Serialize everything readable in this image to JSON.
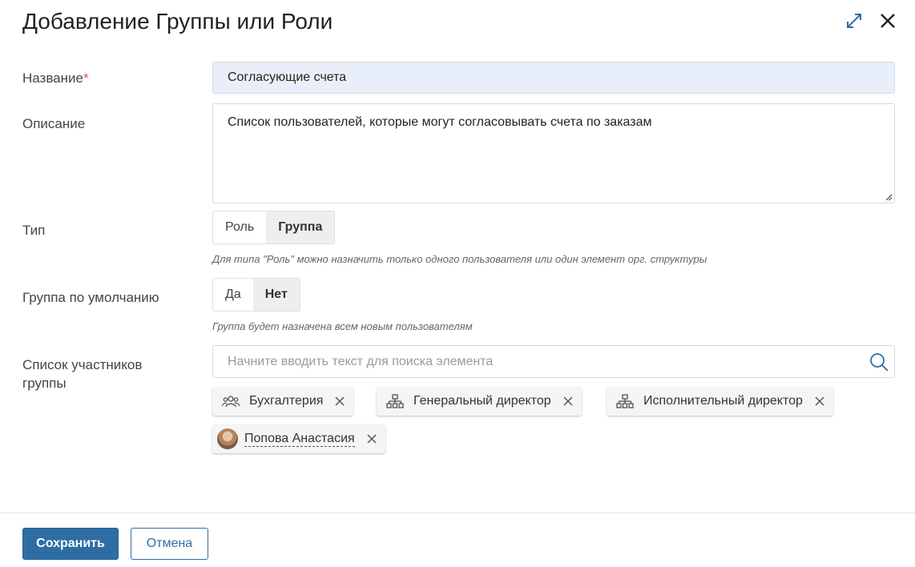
{
  "dialog": {
    "title": "Добавление Группы или Роли",
    "expand_icon": "expand-icon",
    "close_icon": "close-icon"
  },
  "form": {
    "name": {
      "label": "Название",
      "required_mark": "*",
      "value": "Согласующие счета"
    },
    "description": {
      "label": "Описание",
      "value": "Список пользователей, которые могут согласовывать счета по заказам"
    },
    "type": {
      "label": "Тип",
      "options": [
        "Роль",
        "Группа"
      ],
      "selected": "Группа",
      "hint": "Для типа \"Роль\" можно назначить только одного пользователя или один элемент орг. структуры"
    },
    "default_group": {
      "label": "Группа по умолчанию",
      "options": [
        "Да",
        "Нет"
      ],
      "selected": "Нет",
      "hint": "Группа будет назначена всем новым пользователям"
    },
    "members": {
      "label": "Список участников группы",
      "search_placeholder": "Начните вводить текст для поиска элемента",
      "items": [
        {
          "label": "Бухгалтерия",
          "icon": "group-icon"
        },
        {
          "label": "Генеральный директор",
          "icon": "org-structure-icon"
        },
        {
          "label": "Исполнительный директор",
          "icon": "org-structure-icon"
        },
        {
          "label": "Попова Анастасия",
          "icon": "avatar"
        }
      ]
    }
  },
  "footer": {
    "save_label": "Сохранить",
    "cancel_label": "Отмена"
  },
  "colors": {
    "primary": "#2e6da4",
    "name_input_bg": "#e8effa",
    "required": "#d9534f"
  }
}
